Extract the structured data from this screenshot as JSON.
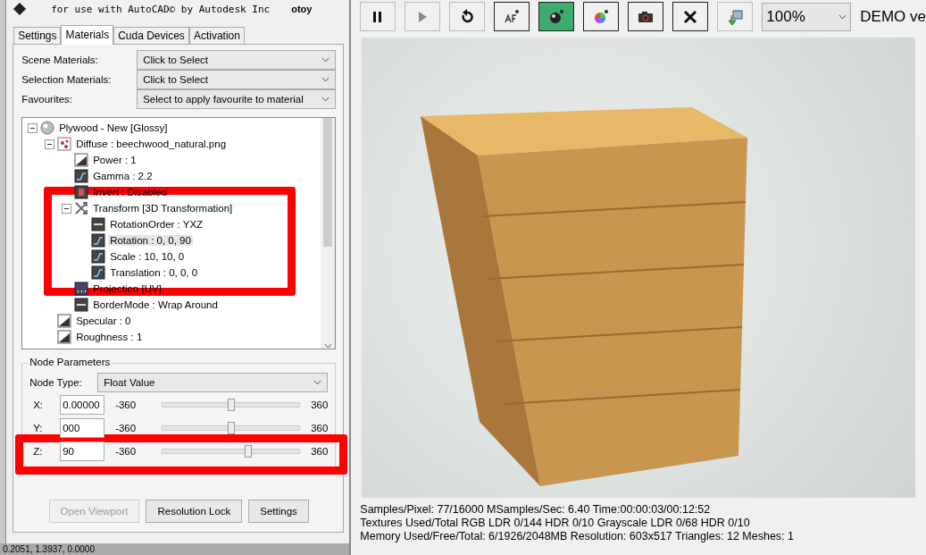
{
  "header": {
    "caption": "for use with AutoCAD© by Autodesk Inc",
    "logo": "otoy"
  },
  "tabs": [
    {
      "label": "Settings",
      "selected": false
    },
    {
      "label": "Materials",
      "selected": true
    },
    {
      "label": "Cuda Devices",
      "selected": false
    },
    {
      "label": "Activation",
      "selected": false
    }
  ],
  "selectors": [
    {
      "label": "Scene Materials:",
      "value": "Click to Select"
    },
    {
      "label": "Selection Materials:",
      "value": "Click to Select"
    },
    {
      "label": "Favourites:",
      "value": "Select to apply favourite to material"
    }
  ],
  "tree": [
    {
      "label": "Plywood - New  [Glossy]",
      "kind": "material",
      "expanded": true,
      "selected": false,
      "children": [
        {
          "label": "Diffuse : beechwood_natural.png",
          "kind": "texture",
          "expanded": true,
          "selected": false,
          "children": [
            {
              "label": "Power : 1",
              "kind": "float",
              "selected": false
            },
            {
              "label": "Gamma : 2.2",
              "kind": "curve",
              "selected": false
            },
            {
              "label": "Invert : Disabled",
              "kind": "toggle",
              "selected": false
            },
            {
              "label": "Transform  [3D Transformation]",
              "kind": "transform",
              "expanded": true,
              "selected": false,
              "children": [
                {
                  "label": "RotationOrder : YXZ",
                  "kind": "enum",
                  "selected": false
                },
                {
                  "label": "Rotation : 0, 0, 90",
                  "kind": "curve",
                  "selected": true
                },
                {
                  "label": "Scale : 10, 10, 0",
                  "kind": "curve",
                  "selected": false
                },
                {
                  "label": "Translation : 0, 0, 0",
                  "kind": "curve",
                  "selected": false
                }
              ]
            },
            {
              "label": "Projection  [UV]",
              "kind": "dots",
              "selected": false
            },
            {
              "label": "BorderMode : Wrap Around",
              "kind": "enum",
              "selected": false
            }
          ]
        },
        {
          "label": "Specular : 0",
          "kind": "float",
          "selected": false
        },
        {
          "label": "Roughness : 1",
          "kind": "float",
          "selected": false
        }
      ]
    }
  ],
  "node_parameters": {
    "title": "Node Parameters",
    "type_label": "Node Type:",
    "type_value": "Float Value",
    "axes": [
      {
        "label": "X:",
        "value": "0.00000",
        "min": "-360",
        "max": "360",
        "level": 0.5
      },
      {
        "label": "Y:",
        "value": "000",
        "min": "-360",
        "max": "360",
        "level": 0.5
      },
      {
        "label": "Z:",
        "value": "90",
        "min": "-360",
        "max": "360",
        "level": 0.625
      }
    ]
  },
  "buttons": [
    {
      "label": "Open Viewport",
      "disabled": true
    },
    {
      "label": "Resolution Lock",
      "disabled": false
    },
    {
      "label": "Settings",
      "disabled": false
    }
  ],
  "autocad_status": "0.2051, 1.3937, 0.0000",
  "toolbar": [
    {
      "kind": "pause",
      "selected": false,
      "framed": false
    },
    {
      "kind": "play",
      "selected": false,
      "framed": false
    },
    {
      "kind": "restart",
      "selected": false,
      "framed": false
    },
    {
      "kind": "focus",
      "selected": false,
      "framed": true
    },
    {
      "kind": "ball",
      "selected": true,
      "framed": true
    },
    {
      "kind": "color",
      "selected": false,
      "framed": true
    },
    {
      "kind": "camera",
      "selected": false,
      "framed": true
    },
    {
      "kind": "close",
      "selected": false,
      "framed": true
    },
    {
      "kind": "export",
      "selected": false,
      "framed": false
    }
  ],
  "zoom": "100%",
  "demo": "DEMO ve",
  "stats": [
    "Samples/Pixel: 77/16000  MSamples/Sec: 6.40  Time:00:00:03/00:12:52",
    "Textures Used/Total RGB LDR 0/144  HDR 0/10  Grayscale LDR 0/68  HDR 0/10",
    "Memory Used/Free/Total: 6/1926/2048MB  Resolution: 603x517  Triangles: 12  Meshes:  1"
  ]
}
